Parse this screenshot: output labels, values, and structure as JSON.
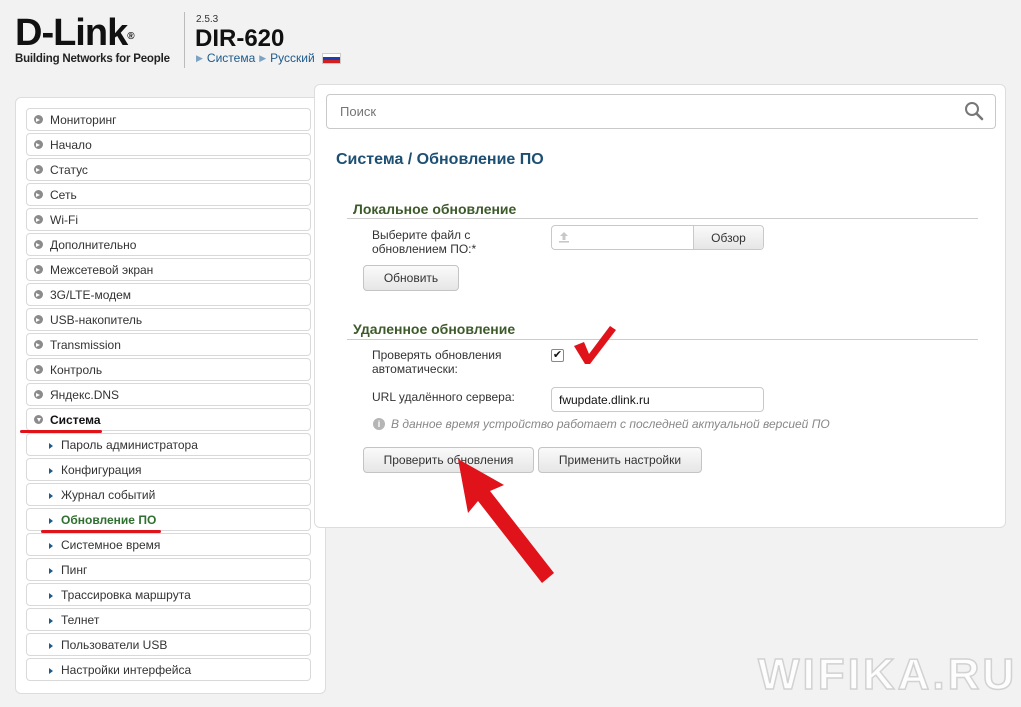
{
  "header": {
    "brand": "D-Link",
    "brand_mark": "®",
    "tagline": "Building Networks for People",
    "version": "2.5.3",
    "model": "DIR-620",
    "crumb_system": "Система",
    "crumb_language": "Русский"
  },
  "sidebar": {
    "items": [
      {
        "label": "Мониторинг"
      },
      {
        "label": "Начало"
      },
      {
        "label": "Статус"
      },
      {
        "label": "Сеть"
      },
      {
        "label": "Wi-Fi"
      },
      {
        "label": "Дополнительно"
      },
      {
        "label": "Межсетевой экран"
      },
      {
        "label": "3G/LTE-модем"
      },
      {
        "label": "USB-накопитель"
      },
      {
        "label": "Transmission"
      },
      {
        "label": "Контроль"
      },
      {
        "label": "Яндекс.DNS"
      },
      {
        "label": "Система"
      }
    ],
    "subitems": [
      {
        "label": "Пароль администратора"
      },
      {
        "label": "Конфигурация"
      },
      {
        "label": "Журнал событий"
      },
      {
        "label": "Обновление ПО"
      },
      {
        "label": "Системное время"
      },
      {
        "label": "Пинг"
      },
      {
        "label": "Трассировка маршрута"
      },
      {
        "label": "Телнет"
      },
      {
        "label": "Пользователи USB"
      },
      {
        "label": "Настройки интерфейса"
      }
    ]
  },
  "main": {
    "search_placeholder": "Поиск",
    "page_title": "Система /  Обновление ПО",
    "local": {
      "title": "Локальное обновление",
      "file_label": "Выберите файл с обновлением ПО:*",
      "browse_label": "Обзор",
      "update_label": "Обновить"
    },
    "remote": {
      "title": "Удаленное обновление",
      "auto_check_label": "Проверять обновления автоматически:",
      "auto_check_checked": true,
      "checkmark": "✔",
      "url_label": "URL удалённого сервера:",
      "url_value": "fwupdate.dlink.ru",
      "info_icon": "i",
      "info_text": "В данное время устройство работает с последней актуальной версией ПО",
      "check_button": "Проверить обновления",
      "apply_button": "Применить настройки"
    }
  },
  "watermark": "WIFIKA.RU",
  "colors": {
    "accent_blue": "#1d5a8a",
    "section_green": "#3c5a2a",
    "annotation_red": "#e0131a"
  }
}
